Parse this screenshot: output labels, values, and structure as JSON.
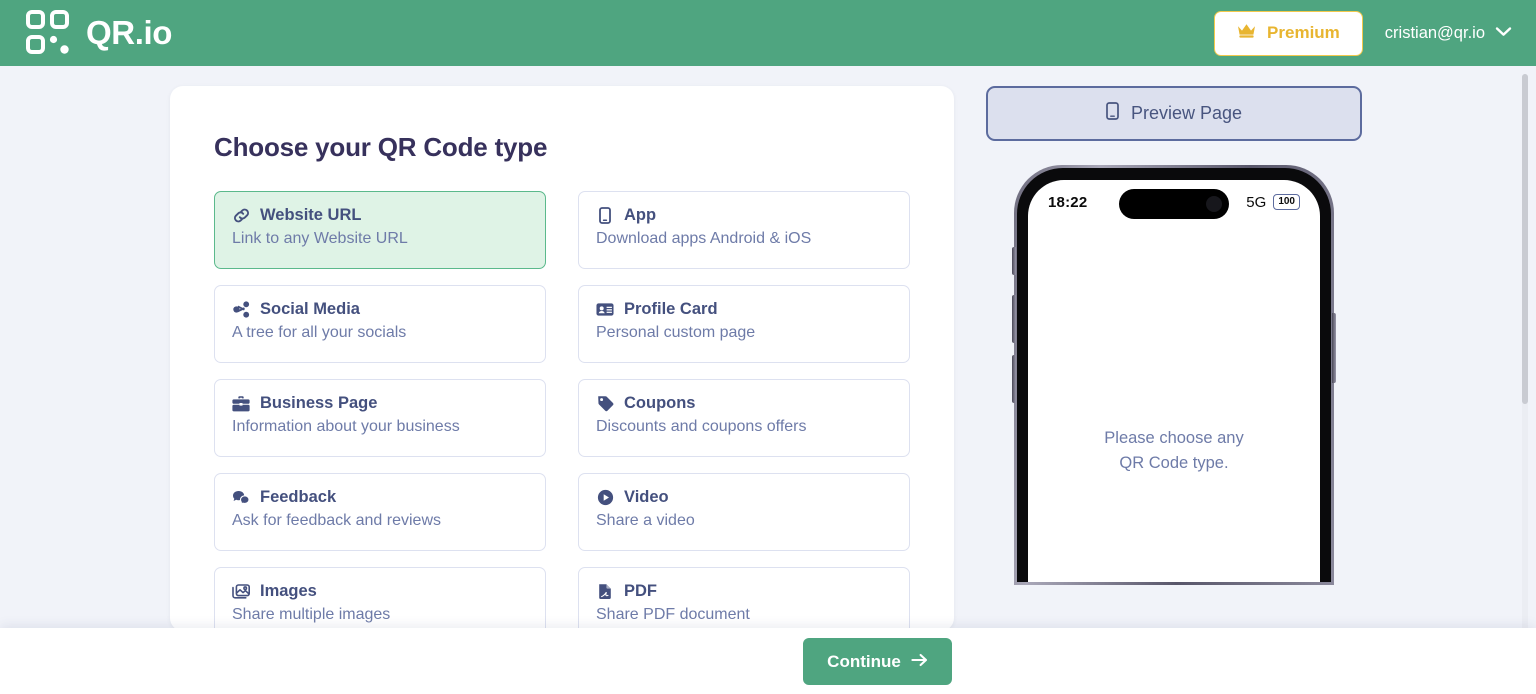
{
  "header": {
    "logo_icon": "qr-code-icon",
    "brand": "QR.io",
    "premium": {
      "icon": "crown-icon",
      "label": "Premium"
    },
    "account": {
      "email": "cristian@qr.io",
      "icon": "chevron-down-icon"
    }
  },
  "chooser": {
    "title": "Choose your QR Code type",
    "types": [
      {
        "icon": "link-icon",
        "label": "Website URL",
        "desc": "Link to any Website URL",
        "selected": true
      },
      {
        "icon": "mobile-icon",
        "label": "App",
        "desc": "Download apps Android & iOS",
        "selected": false
      },
      {
        "icon": "share-icon",
        "label": "Social Media",
        "desc": "A tree for all your socials",
        "selected": false
      },
      {
        "icon": "id-card-icon",
        "label": "Profile Card",
        "desc": "Personal custom page",
        "selected": false
      },
      {
        "icon": "briefcase-icon",
        "label": "Business Page",
        "desc": "Information about your business",
        "selected": false
      },
      {
        "icon": "tag-icon",
        "label": "Coupons",
        "desc": "Discounts and coupons offers",
        "selected": false
      },
      {
        "icon": "comments-icon",
        "label": "Feedback",
        "desc": "Ask for feedback and reviews",
        "selected": false
      },
      {
        "icon": "play-circle-icon",
        "label": "Video",
        "desc": "Share a video",
        "selected": false
      },
      {
        "icon": "images-icon",
        "label": "Images",
        "desc": "Share multiple images",
        "selected": false
      },
      {
        "icon": "pdf-file-icon",
        "label": "PDF",
        "desc": "Share PDF document",
        "selected": false
      }
    ]
  },
  "preview": {
    "button": {
      "icon": "mobile-icon",
      "label": "Preview Page"
    },
    "phone": {
      "time": "18:22",
      "network": "5G",
      "battery": "100",
      "message_line1": "Please choose any",
      "message_line2": "QR Code type."
    }
  },
  "footer": {
    "continue_label": "Continue",
    "continue_icon": "arrow-right-icon"
  },
  "colors": {
    "brand_green": "#4FA580",
    "selected_card_bg": "#DFF3E6",
    "selected_card_border": "#5BB98C",
    "premium_gold": "#E8B530",
    "text_navy": "#44507E",
    "text_muted": "#6E7BA8",
    "page_bg": "#F1F3F9",
    "preview_btn_bg": "#DCE0EE",
    "preview_btn_border": "#5C6B9E"
  }
}
